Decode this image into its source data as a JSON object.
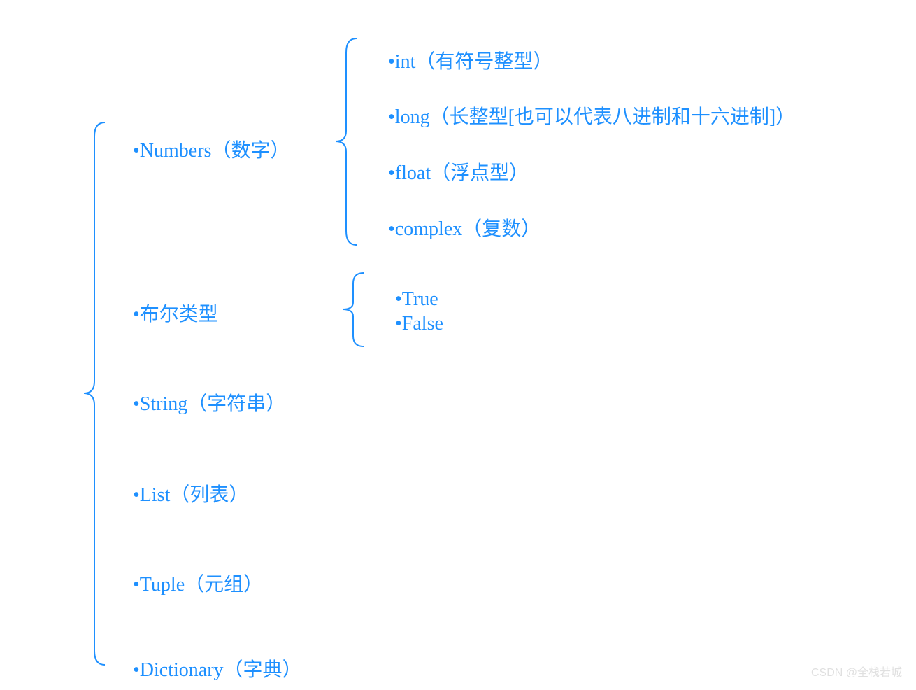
{
  "main_types": [
    "•Numbers（数字）",
    "•布尔类型",
    "•String（字符串）",
    "•List（列表）",
    "•Tuple（元组）",
    "•Dictionary（字典）"
  ],
  "numbers_subtypes": [
    "•int（有符号整型）",
    "•long（长整型[也可以代表八进制和十六进制]）",
    "•float（浮点型）",
    "•complex（复数）"
  ],
  "bool_subtypes": [
    "•True",
    "•False"
  ],
  "watermark": "CSDN @全栈若城",
  "colors": {
    "text": "#1E90FF",
    "brace": "#1E90FF",
    "watermark": "#e0e0e0"
  }
}
